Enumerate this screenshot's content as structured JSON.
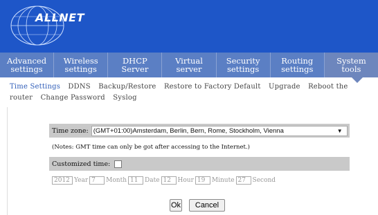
{
  "brand": {
    "logo_text": "ALLNET"
  },
  "nav": [
    {
      "line1": "Advanced",
      "line2": "settings"
    },
    {
      "line1": "Wireless",
      "line2": "settings"
    },
    {
      "line1": "DHCP",
      "line2": "Server"
    },
    {
      "line1": "Virtual",
      "line2": "server"
    },
    {
      "line1": "Security",
      "line2": "settings"
    },
    {
      "line1": "Routing",
      "line2": "settings"
    },
    {
      "line1": "System",
      "line2": "tools"
    }
  ],
  "subnav": {
    "time_settings": "Time Settings",
    "ddns": "DDNS",
    "backup": "Backup/Restore",
    "restore": "Restore to Factory Default",
    "upgrade": "Upgrade",
    "reboot": "Reboot the router",
    "password": "Change Password",
    "syslog": "Syslog"
  },
  "form": {
    "timezone_label": "Time zone:",
    "timezone_value": "(GMT+01:00)Amsterdam, Berlin, Bern, Rome, Stockholm, Vienna",
    "note": "(Notes: GMT time can only be got after accessing to the Internet.)",
    "customized_label": "Customized time:",
    "year_value": "2012",
    "year_label": "Year",
    "month_value": "7",
    "month_label": "Month",
    "date_value": "11",
    "date_label": "Date",
    "hour_value": "12",
    "hour_label": "Hour",
    "minute_value": "19",
    "minute_label": "Minute",
    "second_value": "27",
    "second_label": "Second"
  },
  "buttons": {
    "ok": "Ok",
    "cancel": "Cancel"
  },
  "colors": {
    "header": "#1e56c8",
    "nav": "#5b7fc4",
    "row_shade": "#c9c9c9"
  }
}
